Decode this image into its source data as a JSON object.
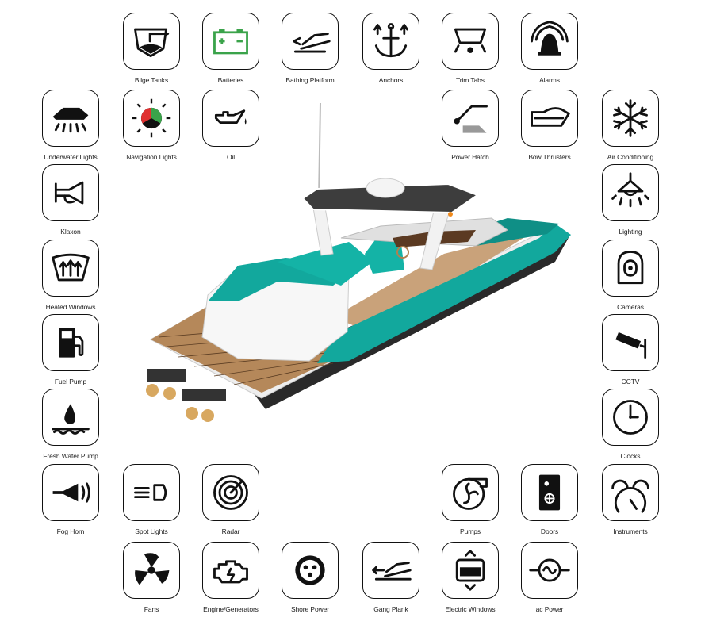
{
  "accent_color": "#12a89d",
  "battery_color": "#3aa34a",
  "tiles": [
    {
      "label": "Bilge Tanks",
      "icon": "bilge-tank-icon"
    },
    {
      "label": "Batteries",
      "icon": "battery-icon"
    },
    {
      "label": "Bathing Platform",
      "icon": "bathing-platform-icon"
    },
    {
      "label": "Anchors",
      "icon": "anchor-icon"
    },
    {
      "label": "Trim Tabs",
      "icon": "trim-tabs-icon"
    },
    {
      "label": "Alarms",
      "icon": "alarm-bell-icon"
    },
    {
      "label": "Underwater Lights",
      "icon": "underwater-lights-icon"
    },
    {
      "label": "Navigation Lights",
      "icon": "navigation-lights-icon"
    },
    {
      "label": "Oil",
      "icon": "oil-can-icon"
    },
    {
      "label": "Power Hatch",
      "icon": "power-hatch-icon"
    },
    {
      "label": "Bow Thrusters",
      "icon": "bow-thruster-icon"
    },
    {
      "label": "Air Conditioning",
      "icon": "snowflake-icon"
    },
    {
      "label": "Klaxon",
      "icon": "klaxon-horn-icon"
    },
    {
      "label": "Heated Windows",
      "icon": "heated-window-icon"
    },
    {
      "label": "Fuel Pump",
      "icon": "fuel-pump-icon"
    },
    {
      "label": "Fresh Water Pump",
      "icon": "water-drop-icon"
    },
    {
      "label": "Fog Horn",
      "icon": "fog-horn-icon"
    },
    {
      "label": "Lighting",
      "icon": "ceiling-light-icon"
    },
    {
      "label": "Cameras",
      "icon": "camera-icon"
    },
    {
      "label": "CCTV",
      "icon": "cctv-icon"
    },
    {
      "label": "Clocks",
      "icon": "clock-icon"
    },
    {
      "label": "Instruments",
      "icon": "gauges-icon"
    },
    {
      "label": "Spot Lights",
      "icon": "spot-light-icon"
    },
    {
      "label": "Radar",
      "icon": "radar-icon"
    },
    {
      "label": "Pumps",
      "icon": "pump-icon"
    },
    {
      "label": "Doors",
      "icon": "door-icon"
    },
    {
      "label": "Fans",
      "icon": "fan-icon"
    },
    {
      "label": "Engine/Generators",
      "icon": "engine-icon"
    },
    {
      "label": "Shore Power",
      "icon": "shore-power-icon"
    },
    {
      "label": "Gang Plank",
      "icon": "gang-plank-icon"
    },
    {
      "label": "Electric Windows",
      "icon": "electric-window-icon"
    },
    {
      "label": "ac Power",
      "icon": "ac-power-icon"
    }
  ]
}
